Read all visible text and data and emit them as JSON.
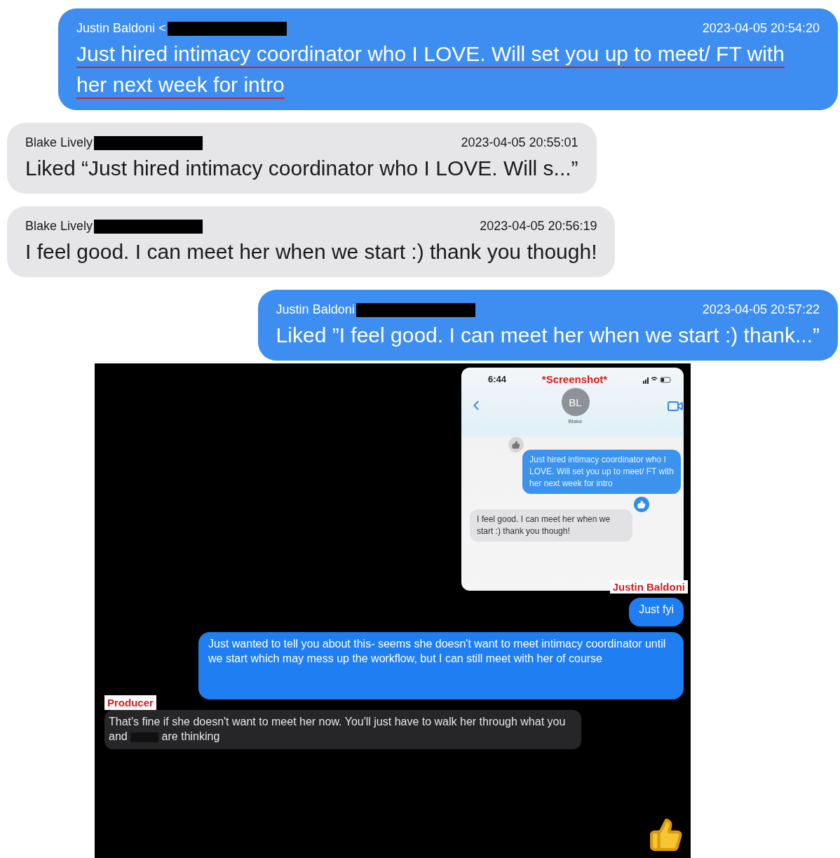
{
  "messages": [
    {
      "kind": "outgoing",
      "sender": "Justin Baldoni <",
      "redacted": true,
      "timestamp": "2023-04-05 20:54:20",
      "text": "Just hired intimacy coordinator who I LOVE. Will set you up to meet/ FT with her next week for intro",
      "underlined": true
    },
    {
      "kind": "incoming",
      "sender": "Blake Lively",
      "redacted": true,
      "timestamp": "2023-04-05 20:55:01",
      "text": "Liked “Just hired intimacy coordinator who I LOVE. Will s...”",
      "underlined": false
    },
    {
      "kind": "incoming",
      "sender": "Blake Lively",
      "redacted": true,
      "timestamp": "2023-04-05 20:56:19",
      "text": "I feel good. I can meet her when we start :) thank you though!",
      "underlined": false
    },
    {
      "kind": "outgoing",
      "sender": "Justin Baldoni",
      "redacted": true,
      "timestamp": "2023-04-05 20:57:22",
      "text": "Liked ”I feel good. I can meet her when we start :) thank...”",
      "underlined": false
    }
  ],
  "evidence_screenshot": {
    "phone": {
      "status_time": "6:44",
      "caption": "*Screenshot*",
      "contact_initials": "BL",
      "contact_name": "Blake",
      "sender_label": "Justin Baldoni",
      "messages": [
        {
          "kind": "outgoing",
          "text": "Just hired intimacy coordinator who I LOVE. Will set you up to meet/ FT with her next week for intro",
          "liked": true
        },
        {
          "kind": "incoming",
          "text": "I feel good. I can meet her when we start :) thank you though!",
          "liked": true
        }
      ]
    },
    "messages": [
      {
        "kind": "outgoing",
        "text": "Just fyi"
      },
      {
        "kind": "outgoing",
        "text": "Just wanted to tell you about this- seems she doesn't want to meet intimacy coordinator until we start which may mess up the workflow, but I can still meet with her of course"
      },
      {
        "kind": "incoming",
        "label": "Producer",
        "text": "That's fine if she doesn't want to meet her now. You'll just have to walk her through what you and",
        "redacted": true,
        "text_after": "are thinking"
      }
    ]
  }
}
